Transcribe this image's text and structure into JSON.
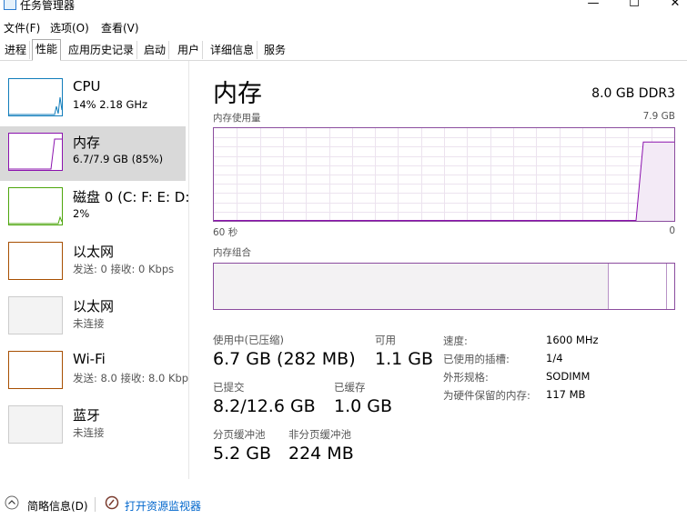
{
  "window": {
    "title": "任务管理器",
    "minimize": "—",
    "maximize": "☐",
    "close": "✕"
  },
  "menu": [
    "文件(F)",
    "选项(O)",
    "查看(V)"
  ],
  "tabs": [
    "进程",
    "性能",
    "应用历史记录",
    "启动",
    "用户",
    "详细信息",
    "服务"
  ],
  "active_tab": "性能",
  "sidebar": [
    {
      "name": "CPU",
      "sub": "14%  2.18 GHz",
      "color": "#117dbb"
    },
    {
      "name": "内存",
      "sub": "6.7/7.9 GB (85%)",
      "color": "#8b12ae"
    },
    {
      "name": "磁盘 0 (C: F: E: D:",
      "sub": "2%",
      "color": "#4da60c"
    },
    {
      "name": "以太网",
      "sub": "发送: 0  接收: 0 Kbps",
      "color": "#a74f01"
    },
    {
      "name": "以太网",
      "sub": "未连接",
      "color": "#aaaaaa"
    },
    {
      "name": "Wi-Fi",
      "sub": "发送: 8.0  接收: 8.0 Kbp",
      "color": "#a74f01"
    },
    {
      "name": "蓝牙",
      "sub": "未连接",
      "color": "#aaaaaa"
    }
  ],
  "main": {
    "title": "内存",
    "spec": "8.0 GB DDR3",
    "usage_label": "内存使用量",
    "usage_max": "7.9 GB",
    "time_left": "60 秒",
    "time_right": "0",
    "composition_label": "内存组合",
    "usage_fraction": 0.85,
    "stats": {
      "in_use_label": "使用中(已压缩)",
      "in_use_value": "6.7 GB (282 MB)",
      "available_label": "可用",
      "available_value": "1.1 GB",
      "committed_label": "已提交",
      "committed_value": "8.2/12.6 GB",
      "cached_label": "已缓存",
      "cached_value": "1.0 GB",
      "paged_label": "分页缓冲池",
      "paged_value": "5.2 GB",
      "nonpaged_label": "非分页缓冲池",
      "nonpaged_value": "224 MB"
    },
    "props": [
      {
        "k": "速度:",
        "v": "1600 MHz"
      },
      {
        "k": "已使用的插槽:",
        "v": "1/4"
      },
      {
        "k": "外形规格:",
        "v": "SODIMM"
      },
      {
        "k": "为硬件保留的内存:",
        "v": "117 MB"
      }
    ]
  },
  "bottom": {
    "summary": "简略信息(D)",
    "monitor": "打开资源监视器"
  }
}
